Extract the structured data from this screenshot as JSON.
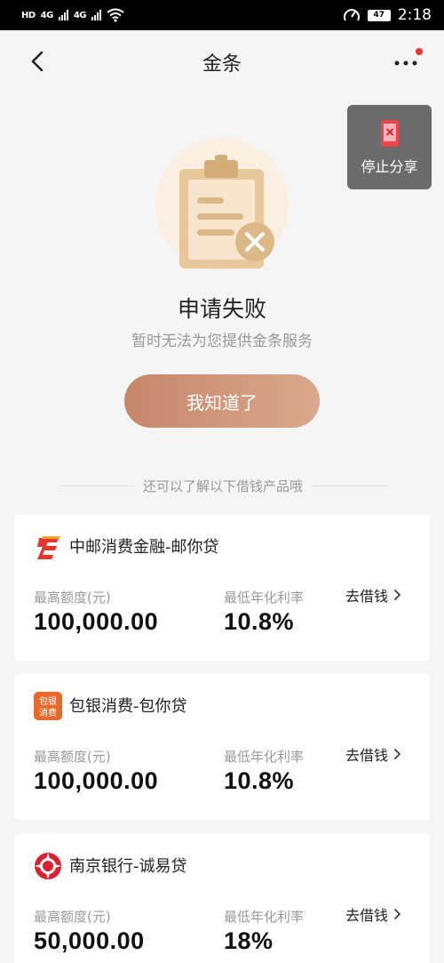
{
  "status_bar": {
    "left_labels": [
      "HD",
      "4G",
      "4G"
    ],
    "battery": "47",
    "time": "2:18"
  },
  "header": {
    "title": "金条"
  },
  "floating": {
    "stop_share_label": "停止分享"
  },
  "result": {
    "title": "申请失败",
    "subtitle": "暂时无法为您提供金条服务",
    "button_label": "我知道了"
  },
  "divider_text": "还可以了解以下借钱产品哦",
  "products": [
    {
      "name": "中邮消费金融-邮你贷",
      "limit_label": "最高额度(元)",
      "limit_value": "100,000.00",
      "rate_label": "最低年化利率",
      "rate_value": "10.8%",
      "action_label": "去借钱",
      "logo_icon": "china-post-logo-icon"
    },
    {
      "name": "包银消费-包你贷",
      "limit_label": "最高额度(元)",
      "limit_value": "100,000.00",
      "rate_label": "最低年化利率",
      "rate_value": "10.8%",
      "action_label": "去借钱",
      "logo_icon": "baoyin-logo-icon",
      "logo_text": "包银消费"
    },
    {
      "name": "南京银行-诚易贷",
      "limit_label": "最高额度(元)",
      "limit_value": "50,000.00",
      "rate_label": "最低年化利率",
      "rate_value": "18%",
      "action_label": "去借钱",
      "logo_icon": "bank-of-nanjing-logo-icon"
    }
  ],
  "colors": {
    "accent": "#d49a7c",
    "notification_dot": "#e5362c"
  }
}
